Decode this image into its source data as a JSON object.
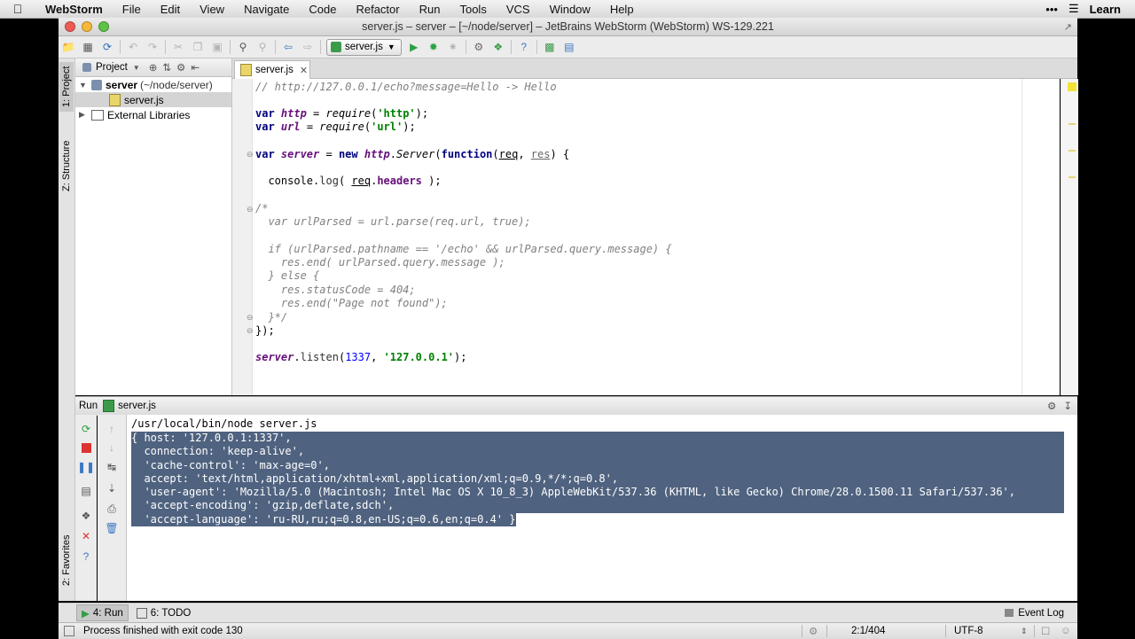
{
  "menubar": {
    "app": "WebStorm",
    "items": [
      "File",
      "Edit",
      "View",
      "Navigate",
      "Code",
      "Refactor",
      "Run",
      "Tools",
      "VCS",
      "Window",
      "Help"
    ],
    "right_text": "Learn"
  },
  "window": {
    "title": "server.js – server – [~/node/server] – JetBrains WebStorm (WebStorm) WS-129.221"
  },
  "toolbar": {
    "run_config": "server.js"
  },
  "left_strip": {
    "project_tab": "1: Project",
    "structure_tab": "Z: Structure",
    "favorites_tab": "2: Favorites"
  },
  "project_panel": {
    "header": "Project",
    "root_name": "server",
    "root_path": "(~/node/server)",
    "file": "server.js",
    "external": "External Libraries"
  },
  "editor": {
    "tab": "server.js",
    "lines": {
      "l1": "// http://127.0.0.1/echo?message=Hello -> Hello",
      "l3a": "var ",
      "l3b": "http",
      "l3c": " = ",
      "l3d": "require",
      "l3e": "(",
      "l3f": "'http'",
      "l3g": ");",
      "l4a": "var ",
      "l4b": "url",
      "l4c": " = ",
      "l4d": "require",
      "l4e": "(",
      "l4f": "'url'",
      "l4g": ");",
      "l6a": "var ",
      "l6b": "server",
      "l6c": " = ",
      "l6d": "new ",
      "l6e": "http",
      "l6f": ".",
      "l6g": "Server",
      "l6h": "(",
      "l6i": "function",
      "l6j": "(",
      "l6k": "req",
      "l6l": ", ",
      "l6m": "res",
      "l6n": ") {",
      "l8a": "  console",
      "l8b": ".",
      "l8c": "log",
      "l8d": "( ",
      "l8e": "req",
      "l8f": ".",
      "l8g": "headers",
      "l8h": " );",
      "l10": "/*",
      "l11": "  var urlParsed = url.parse(req.url, true);",
      "l13": "  if (urlParsed.pathname == '/echo' && urlParsed.query.message) {",
      "l14": "    res.end( urlParsed.query.message );",
      "l15": "  } else {",
      "l16": "    res.statusCode = 404;",
      "l17": "    res.end(\"Page not found\");",
      "l18": "  }*/",
      "l19": "});",
      "l21a": "server",
      "l21b": ".",
      "l21c": "listen",
      "l21d": "(",
      "l21e": "1337",
      "l21f": ", ",
      "l21g": "'127.0.0.1'",
      "l21h": ");"
    }
  },
  "run_panel": {
    "label": "Run",
    "config": "server.js",
    "console": [
      "/usr/local/bin/node server.js",
      "{ host: '127.0.0.1:1337',",
      "  connection: 'keep-alive',",
      "  'cache-control': 'max-age=0',",
      "  accept: 'text/html,application/xhtml+xml,application/xml;q=0.9,*/*;q=0.8',",
      "  'user-agent': 'Mozilla/5.0 (Macintosh; Intel Mac OS X 10_8_3) AppleWebKit/537.36 (KHTML, like Gecko) Chrome/28.0.1500.11 Safari/537.36',",
      "  'accept-encoding': 'gzip,deflate,sdch',",
      "  'accept-language': 'ru-RU,ru;q=0.8,en-US;q=0.6,en;q=0.4' }"
    ]
  },
  "bottom_tabs": {
    "run": "4: Run",
    "todo": "6: TODO",
    "event_log": "Event Log"
  },
  "status": {
    "message": "Process finished with exit code 130",
    "position": "2:1/404",
    "encoding": "UTF-8"
  },
  "colors": {
    "selection": "#4f627f",
    "keyword": "#000080",
    "string": "#008000",
    "number": "#0000ff",
    "comment": "#808080",
    "current_line": "#fffae3"
  }
}
